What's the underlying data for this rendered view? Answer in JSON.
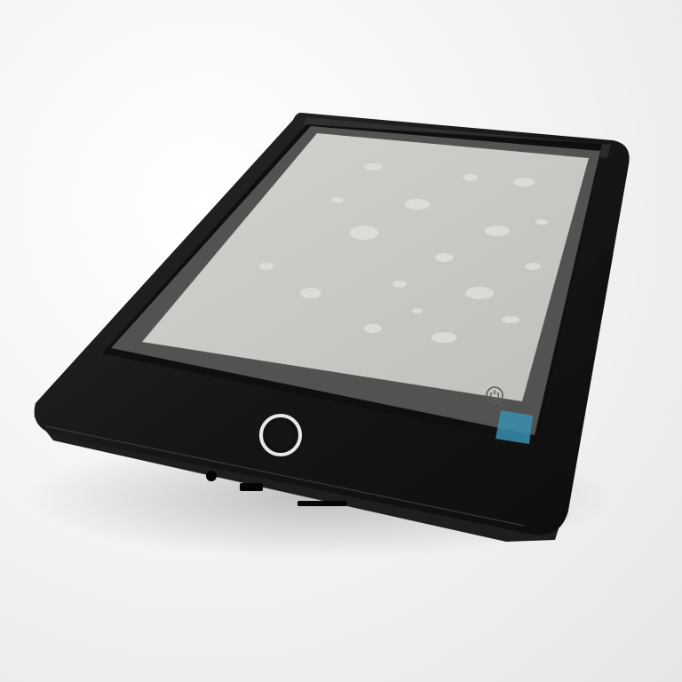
{
  "scene": {
    "subject": "ereader",
    "colors": {
      "background": "#f0f0f0",
      "device_body": "#161616",
      "device_edge": "#2a2a2a",
      "screen": "#c9cac4",
      "screen_film": "#d3d4cf",
      "button_ring": "#e8e8e8",
      "tab": "#3a8fb0"
    },
    "icons": {
      "home_button": "ring-button-icon",
      "power_symbol": "power-icon"
    }
  }
}
